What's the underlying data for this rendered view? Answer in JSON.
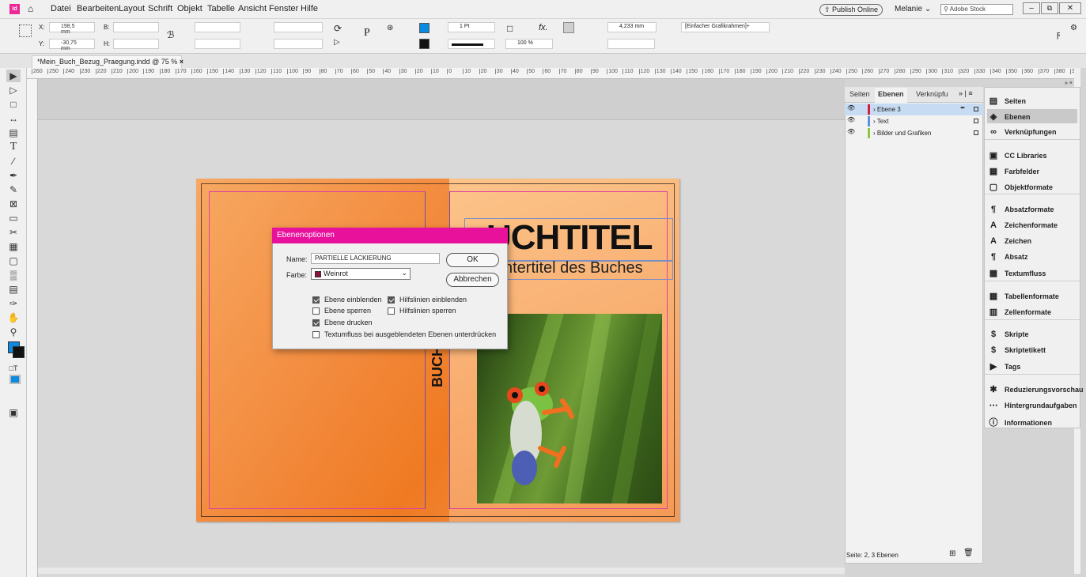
{
  "menubar": {
    "app_icon": "Id",
    "items": [
      "Datei",
      "Bearbeiten",
      "Layout",
      "Schrift",
      "Objekt",
      "Tabelle",
      "Ansicht",
      "Fenster",
      "Hilfe"
    ],
    "publish": "Publish Online",
    "user": "Melanie",
    "search_placeholder": "Adobe Stock"
  },
  "control": {
    "x_label": "X:",
    "x_value": "198,5 mm",
    "y_label": "Y:",
    "y_value": "-30,75 mm",
    "b_label": "B:",
    "h_label": "H:",
    "stroke_weight": "1 Pt",
    "zoom_percent": "100 %",
    "dim_value": "4,233 mm",
    "frame_style": "[Einfacher Grafikrahmen]+"
  },
  "document_tab": "*Mein_Buch_Bezug_Praegung.indd @ 75 %",
  "ruler_labels": [
    "260",
    "250",
    "240",
    "230",
    "220",
    "210",
    "200",
    "190",
    "180",
    "170",
    "160",
    "150",
    "140",
    "130",
    "120",
    "110",
    "100",
    "90",
    "80",
    "70",
    "60",
    "50",
    "40",
    "30",
    "20",
    "10",
    "0",
    "10",
    "20",
    "30",
    "40",
    "50",
    "60",
    "70",
    "80",
    "90",
    "100",
    "110",
    "120",
    "130",
    "140",
    "150",
    "160",
    "170",
    "180",
    "190",
    "200",
    "210",
    "220",
    "230",
    "240",
    "250",
    "260",
    "270",
    "280",
    "290",
    "300",
    "310",
    "320",
    "330",
    "340",
    "350",
    "360",
    "370",
    "380",
    "3"
  ],
  "cover": {
    "title": "BUCHTITEL",
    "title_visible": "UCHTITEL",
    "subtitle": "Untertitel des Buches",
    "subtitle_visible": "ntertitel des Buches",
    "spine_text": "BUCH"
  },
  "dialog": {
    "title": "Ebenenoptionen",
    "name_label": "Name:",
    "name_value": "PARTIELLE LACKIERUNG",
    "color_label": "Farbe:",
    "color_value": "Weinrot",
    "ok": "OK",
    "cancel": "Abbrechen",
    "options": [
      {
        "label": "Ebene einblenden",
        "checked": true
      },
      {
        "label": "Hilfslinien einblenden",
        "checked": true
      },
      {
        "label": "Ebene sperren",
        "checked": false
      },
      {
        "label": "Hilfslinien sperren",
        "checked": false
      },
      {
        "label": "Ebene drucken",
        "checked": true
      },
      {
        "label": "Textumfluss bei ausgeblendeten Ebenen unterdrücken",
        "checked": false
      }
    ]
  },
  "layers_panel": {
    "tabs": [
      "Seiten",
      "Ebenen",
      "Verknüpfu"
    ],
    "layers": [
      {
        "name": "Ebene 3",
        "color": "#d81b3c",
        "selected": true
      },
      {
        "name": "Text",
        "color": "#5b8fe0",
        "selected": false
      },
      {
        "name": "Bilder und Grafiken",
        "color": "#8ec641",
        "selected": false
      }
    ],
    "status": "Seite: 2, 3 Ebenen"
  },
  "right_panel": {
    "items": [
      {
        "label": "Seiten",
        "icon": "pages-icon"
      },
      {
        "label": "Ebenen",
        "icon": "layers-icon",
        "active": true
      },
      {
        "label": "Verknüpfungen",
        "icon": "links-icon"
      },
      {
        "label": "CC Libraries",
        "icon": "cc-libraries-icon"
      },
      {
        "label": "Farbfelder",
        "icon": "swatches-icon"
      },
      {
        "label": "Objektformate",
        "icon": "object-styles-icon"
      },
      {
        "label": "Absatzformate",
        "icon": "paragraph-styles-icon"
      },
      {
        "label": "Zeichenformate",
        "icon": "character-styles-icon"
      },
      {
        "label": "Zeichen",
        "icon": "character-icon"
      },
      {
        "label": "Absatz",
        "icon": "paragraph-icon"
      },
      {
        "label": "Textumfluss",
        "icon": "text-wrap-icon"
      },
      {
        "label": "Tabellenformate",
        "icon": "table-styles-icon"
      },
      {
        "label": "Zellenformate",
        "icon": "cell-styles-icon"
      },
      {
        "label": "Skripte",
        "icon": "scripts-icon"
      },
      {
        "label": "Skriptetikett",
        "icon": "script-label-icon"
      },
      {
        "label": "Tags",
        "icon": "tags-icon"
      },
      {
        "label": "Reduzierungsvorschau",
        "icon": "flattener-preview-icon"
      },
      {
        "label": "Hintergrundaufgaben",
        "icon": "background-tasks-icon"
      },
      {
        "label": "Informationen",
        "icon": "info-icon"
      }
    ]
  },
  "colors": {
    "dialog_title_bg": "#e8119c",
    "weinrot": "#8a1538",
    "accent_blue": "#0a8ae0"
  }
}
